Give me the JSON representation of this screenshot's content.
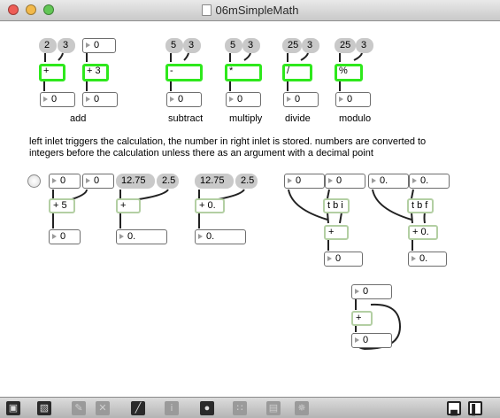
{
  "window": {
    "title": "06mSimpleMath"
  },
  "colors": {
    "active_object": "#2ee81c",
    "object": "#b3cfa3",
    "message": "#c9c9c9",
    "close": "#ee5c55",
    "minimize": "#f2b94a",
    "zoom": "#62c655"
  },
  "ops": {
    "add": {
      "msg_a": "2",
      "msg_b": "3",
      "obj": "+",
      "out": "0",
      "num2": "0",
      "obj2": "+ 3",
      "out2": "0",
      "label": "add"
    },
    "subtract": {
      "msg_a": "5",
      "msg_b": "3",
      "obj": "-",
      "out": "0",
      "label": "subtract"
    },
    "multiply": {
      "msg_a": "5",
      "msg_b": "3",
      "obj": "*",
      "out": "0",
      "label": "multiply"
    },
    "divide": {
      "msg_a": "25",
      "msg_b": "3",
      "obj": "/",
      "out": "0",
      "label": "divide"
    },
    "modulo": {
      "msg_a": "25",
      "msg_b": "3",
      "obj": "%",
      "out": "0",
      "label": "modulo"
    }
  },
  "comment": "left inlet triggers the calculation, the number in right inlet is stored. numbers are converted to integers before the calculation unless there as an argument with a decimal point",
  "row2": {
    "in_left": "0",
    "in_right": "0",
    "plus5": "+ 5",
    "out1": "0",
    "msg_a": "12.75",
    "msg_b": "2.5",
    "plus": "+",
    "out2": "0.",
    "msg_c": "12.75",
    "msg_d": "2.5",
    "plus_f": "+ 0.",
    "out3": "0."
  },
  "trig": {
    "i_in_a": "0",
    "i_in_b": "0",
    "tbi": "t b i",
    "i_plus": "+",
    "i_out": "0",
    "f_in_a": "0.",
    "f_in_b": "0.",
    "tbf": "t b f",
    "f_plus": "+ 0.",
    "f_out": "0."
  },
  "loop": {
    "in": "0",
    "plus": "+",
    "out": "0"
  },
  "toolbar": {
    "icons": [
      "lock-icon",
      "presentation-icon",
      "paint-icon",
      "clear-icon",
      "inspector-chart-icon",
      "info-icon",
      "connect-icon",
      "grid-icon",
      "debug-icon",
      "snapshot-icon",
      "sidebar-icon",
      "fullscreen-icon"
    ]
  }
}
